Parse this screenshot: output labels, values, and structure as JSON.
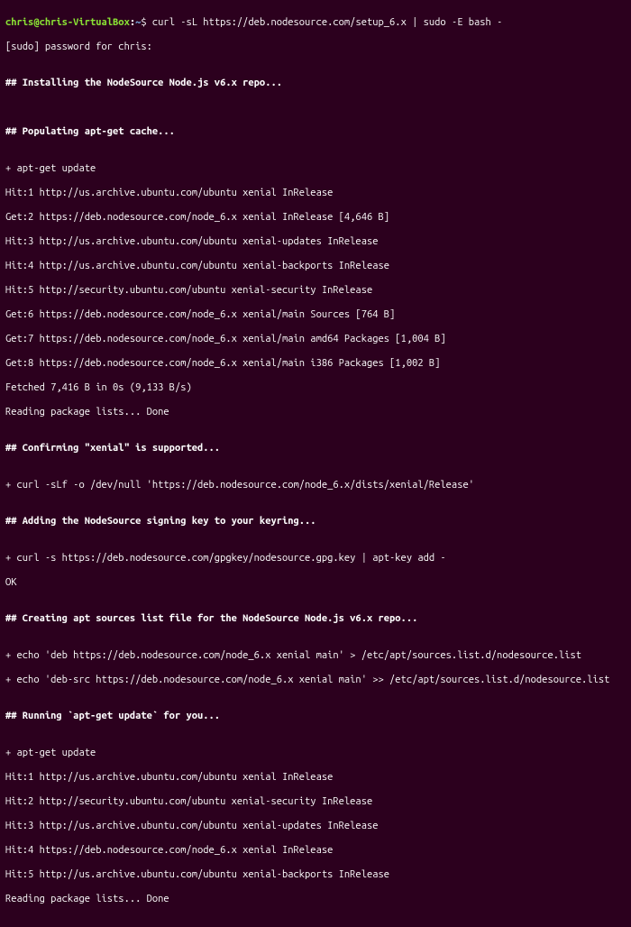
{
  "prompt": {
    "user": "chris",
    "at": "@",
    "host": "chris-VirtualBox",
    "colon": ":",
    "path": "~",
    "dollar": "$ ",
    "command": "curl -sL https://deb.nodesource.com/setup_6.x | sudo -E bash -"
  },
  "lines": {
    "l1": "[sudo] password for chris: ",
    "l2": "",
    "l3": "## Installing the NodeSource Node.js v6.x repo...",
    "l4": "",
    "l5": "",
    "l6": "## Populating apt-get cache...",
    "l7": "",
    "l8": "+ apt-get update",
    "l9": "Hit:1 http://us.archive.ubuntu.com/ubuntu xenial InRelease",
    "l10": "Get:2 https://deb.nodesource.com/node_6.x xenial InRelease [4,646 B]",
    "l11": "Hit:3 http://us.archive.ubuntu.com/ubuntu xenial-updates InRelease",
    "l12": "Hit:4 http://us.archive.ubuntu.com/ubuntu xenial-backports InRelease",
    "l13": "Hit:5 http://security.ubuntu.com/ubuntu xenial-security InRelease",
    "l14": "Get:6 https://deb.nodesource.com/node_6.x xenial/main Sources [764 B]",
    "l15": "Get:7 https://deb.nodesource.com/node_6.x xenial/main amd64 Packages [1,004 B]",
    "l16": "Get:8 https://deb.nodesource.com/node_6.x xenial/main i386 Packages [1,002 B]",
    "l17": "Fetched 7,416 B in 0s (9,133 B/s)                         ",
    "l18": "Reading package lists... Done",
    "l19": "",
    "l20": "## Confirming \"xenial\" is supported...",
    "l21": "",
    "l22": "+ curl -sLf -o /dev/null 'https://deb.nodesource.com/node_6.x/dists/xenial/Release'",
    "l23": "",
    "l24": "## Adding the NodeSource signing key to your keyring...",
    "l25": "",
    "l26": "+ curl -s https://deb.nodesource.com/gpgkey/nodesource.gpg.key | apt-key add -",
    "l27": "OK",
    "l28": "",
    "l29": "## Creating apt sources list file for the NodeSource Node.js v6.x repo...",
    "l30": "",
    "l31": "+ echo 'deb https://deb.nodesource.com/node_6.x xenial main' > /etc/apt/sources.list.d/nodesource.list",
    "l32": "+ echo 'deb-src https://deb.nodesource.com/node_6.x xenial main' >> /etc/apt/sources.list.d/nodesource.list",
    "l33": "",
    "l34": "## Running `apt-get update` for you...",
    "l35": "",
    "l36": "+ apt-get update",
    "l37": "Hit:1 http://us.archive.ubuntu.com/ubuntu xenial InRelease",
    "l38": "Hit:2 http://security.ubuntu.com/ubuntu xenial-security InRelease",
    "l39": "Hit:3 http://us.archive.ubuntu.com/ubuntu xenial-updates InRelease",
    "l40": "Hit:4 https://deb.nodesource.com/node_6.x xenial InRelease",
    "l41": "Hit:5 http://us.archive.ubuntu.com/ubuntu xenial-backports InRelease",
    "l42": "Reading package lists... Done"
  }
}
